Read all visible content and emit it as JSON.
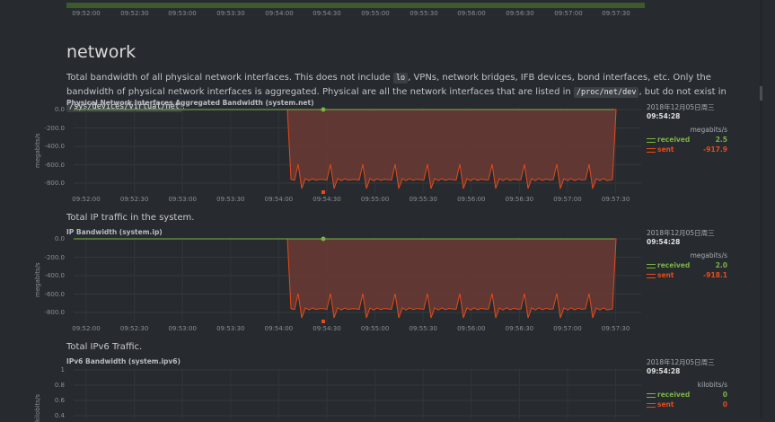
{
  "top_axis": {
    "ticks": [
      "09:52:00",
      "09:52:30",
      "09:53:00",
      "09:53:30",
      "09:54:00",
      "09:54:30",
      "09:55:00",
      "09:55:30",
      "09:56:00",
      "09:56:30",
      "09:57:00",
      "09:57:30"
    ]
  },
  "section": {
    "title": "network",
    "paragraph": {
      "t1": "Total bandwidth of all physical network interfaces. This does not include ",
      "c1": "lo",
      "t2": ", VPNs, network bridges, IFB devices, bond interfaces, etc. Only the bandwidth of physical network interfaces is aggregated. Physical are all the network interfaces that are listed in ",
      "c2": "/proc/net/dev",
      "t3": ", but do not exist in ",
      "c3": "/sys/devices/virtual/net",
      "t4": "."
    }
  },
  "colors": {
    "received": "#7cb342",
    "sent": "#e64a19",
    "area": "#6b3a33"
  },
  "charts": [
    {
      "title": "Physical Network Interfaces Aggregated Bandwidth (system.net)",
      "description": "",
      "ylabel": "megabits/s",
      "yticks": [
        "0.0",
        "-200.0",
        "-400.0",
        "-600.0",
        "-800.0"
      ],
      "xticks": [
        "09:52:00",
        "09:52:30",
        "09:53:00",
        "09:53:30",
        "09:54:00",
        "09:54:30",
        "09:55:00",
        "09:55:30",
        "09:56:00",
        "09:56:30",
        "09:57:00",
        "09:57:30"
      ],
      "legend": {
        "date": "2018年12月05日周三",
        "time": "09:54:28",
        "units": "megabits/s",
        "received_label": "received",
        "received_value": "2.5",
        "sent_label": "sent",
        "sent_value": "-917.9"
      }
    },
    {
      "title": "IP Bandwidth (system.ip)",
      "description": "Total IP traffic in the system.",
      "ylabel": "megabits/s",
      "yticks": [
        "0.0",
        "-200.0",
        "-400.0",
        "-600.0",
        "-800.0"
      ],
      "xticks": [
        "09:52:00",
        "09:52:30",
        "09:53:00",
        "09:53:30",
        "09:54:00",
        "09:54:30",
        "09:55:00",
        "09:55:30",
        "09:56:00",
        "09:56:30",
        "09:57:00",
        "09:57:30"
      ],
      "legend": {
        "date": "2018年12月05日周三",
        "time": "09:54:28",
        "units": "megabits/s",
        "received_label": "received",
        "received_value": "2.0",
        "sent_label": "sent",
        "sent_value": "-918.1"
      }
    },
    {
      "title": "IPv6 Bandwidth (system.ipv6)",
      "description": "Total IPv6 Traffic.",
      "ylabel": "kilobits/s",
      "yticks": [
        "1",
        "0.8",
        "0.6",
        "0.4"
      ],
      "legend": {
        "date": "2018年12月05日周三",
        "time": "09:54:28",
        "units": "kilobits/s",
        "received_label": "received",
        "received_value": "0",
        "sent_label": "sent",
        "sent_value": "0"
      }
    }
  ]
}
